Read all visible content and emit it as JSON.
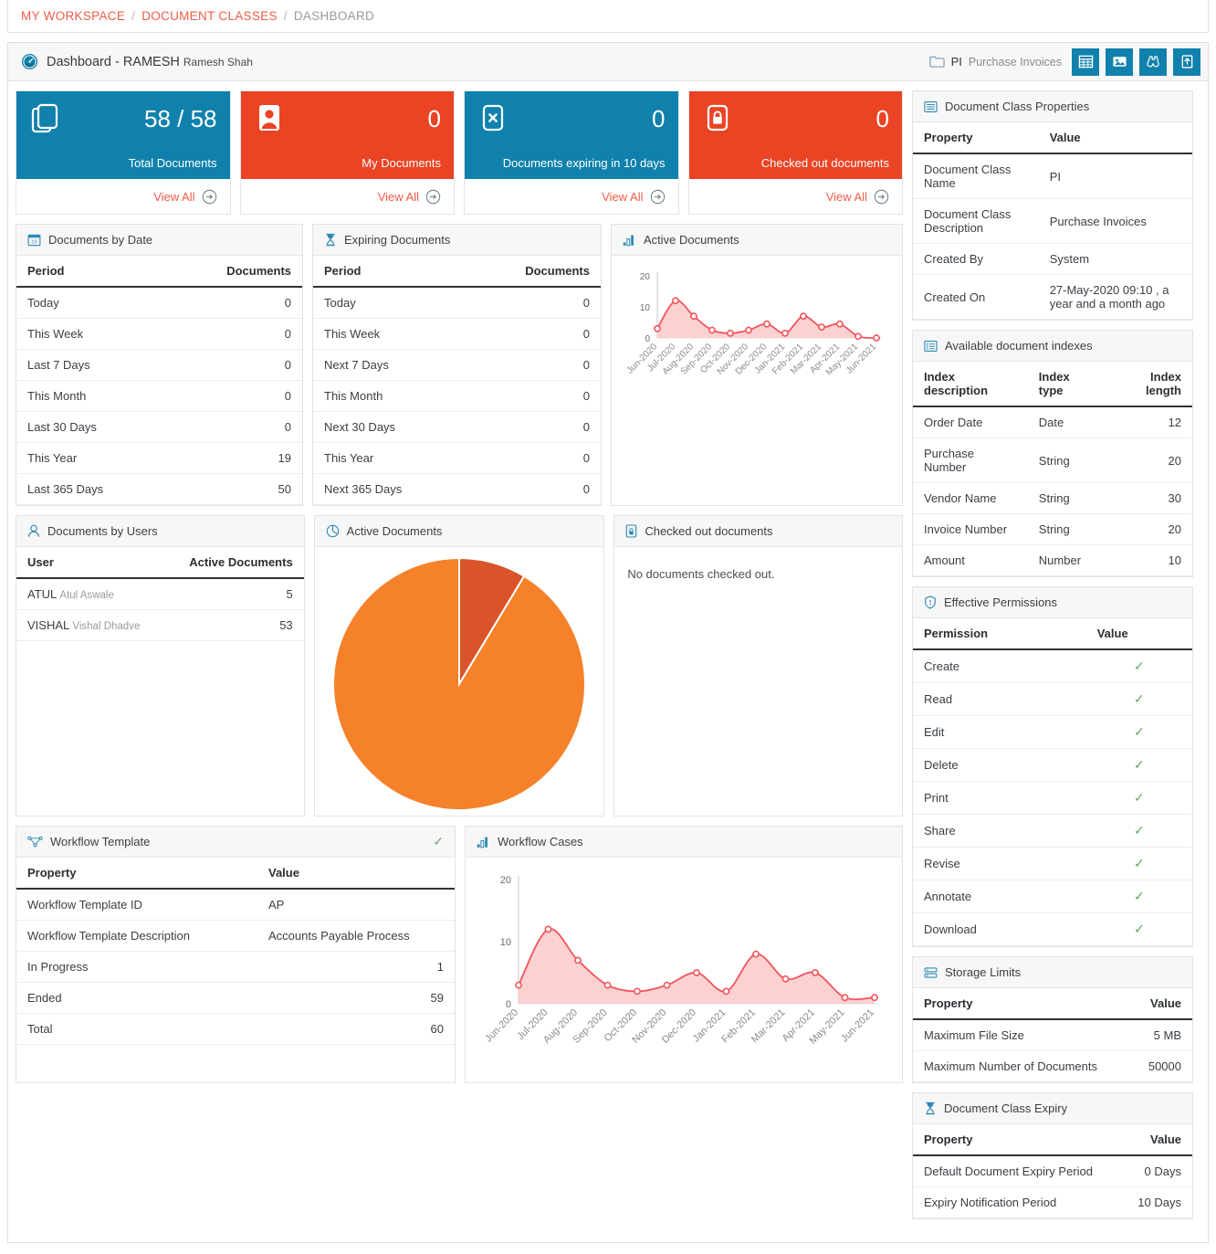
{
  "breadcrumb": {
    "workspace": "MY WORKSPACE",
    "document_classes": "DOCUMENT CLASSES",
    "current": "DASHBOARD",
    "sep": "/"
  },
  "header": {
    "icon": "dashboard-gauge-icon",
    "title_main": "Dashboard - RAMESH ",
    "title_sub": "Ramesh Shah",
    "folder_icon": "folder-icon",
    "folder_code": "PI",
    "folder_desc": "Purchase Invoices",
    "tools": [
      {
        "name": "grid-view-button",
        "icon": "grid-icon"
      },
      {
        "name": "image-view-button",
        "icon": "image-icon"
      },
      {
        "name": "search-button",
        "icon": "binoculars-icon"
      },
      {
        "name": "upload-button",
        "icon": "upload-icon"
      }
    ]
  },
  "kpi_cards": [
    {
      "icon": "documents-stack-icon",
      "value": "58 / 58",
      "label": "Total Documents",
      "color": "blue",
      "view_all": "View All"
    },
    {
      "icon": "user-card-icon",
      "value": "0",
      "label": "My Documents",
      "color": "red",
      "view_all": "View All"
    },
    {
      "icon": "expired-x-icon",
      "value": "0",
      "label": "Documents expiring in 10 days",
      "color": "blue",
      "view_all": "View All"
    },
    {
      "icon": "lock-icon",
      "value": "0",
      "label": "Checked out documents",
      "color": "red",
      "view_all": "View All"
    }
  ],
  "documents_by_date": {
    "icon": "calendar-icon",
    "title": "Documents by Date",
    "columns": [
      "Period",
      "Documents"
    ],
    "rows": [
      [
        "Today",
        "0"
      ],
      [
        "This Week",
        "0"
      ],
      [
        "Last 7 Days",
        "0"
      ],
      [
        "This Month",
        "0"
      ],
      [
        "Last 30 Days",
        "0"
      ],
      [
        "This Year",
        "19"
      ],
      [
        "Last 365 Days",
        "50"
      ]
    ]
  },
  "expiring_documents": {
    "icon": "hourglass-icon",
    "title": "Expiring Documents",
    "columns": [
      "Period",
      "Documents"
    ],
    "rows": [
      [
        "Today",
        "0"
      ],
      [
        "This Week",
        "0"
      ],
      [
        "Next 7 Days",
        "0"
      ],
      [
        "This Month",
        "0"
      ],
      [
        "Next 30 Days",
        "0"
      ],
      [
        "This Year",
        "0"
      ],
      [
        "Next 365 Days",
        "0"
      ]
    ]
  },
  "documents_by_users": {
    "icon": "user-icon",
    "title": "Documents by Users",
    "columns": [
      "User",
      "Active Documents"
    ],
    "rows": [
      {
        "code": "ATUL",
        "name": "Atul Aswale",
        "count": "5"
      },
      {
        "code": "VISHAL",
        "name": "Vishal Dhadve",
        "count": "53"
      }
    ]
  },
  "active_documents_pie": {
    "icon": "pie-chart-icon",
    "title": "Active Documents"
  },
  "checked_out": {
    "icon": "lock-small-icon",
    "title": "Checked out documents",
    "message": "No documents checked out."
  },
  "workflow_template": {
    "icon": "workflow-icon",
    "title": "Workflow Template",
    "status_icon": "check-icon",
    "columns": [
      "Property",
      "Value"
    ],
    "rows": [
      {
        "prop": "Workflow Template ID",
        "value": "AP",
        "align": "left"
      },
      {
        "prop": "Workflow Template Description",
        "value": "Accounts Payable Process",
        "align": "left"
      },
      {
        "prop": "In Progress",
        "value": "1",
        "align": "right"
      },
      {
        "prop": "Ended",
        "value": "59",
        "align": "right"
      },
      {
        "prop": "Total",
        "value": "60",
        "align": "right"
      }
    ]
  },
  "document_class_properties": {
    "icon": "properties-list-icon",
    "title": "Document Class Properties",
    "columns": [
      "Property",
      "Value"
    ],
    "rows": [
      [
        "Document Class Name",
        "PI"
      ],
      [
        "Document Class Description",
        "Purchase Invoices"
      ],
      [
        "Created By",
        "System"
      ],
      [
        "Created On",
        "27-May-2020 09:10 , a year and a month ago"
      ]
    ]
  },
  "available_indexes": {
    "icon": "index-list-icon",
    "title": "Available document indexes",
    "columns": [
      "Index description",
      "Index type",
      "Index length"
    ],
    "rows": [
      [
        "Order Date",
        "Date",
        "12"
      ],
      [
        "Purchase Number",
        "String",
        "20"
      ],
      [
        "Vendor Name",
        "String",
        "30"
      ],
      [
        "Invoice Number",
        "String",
        "20"
      ],
      [
        "Amount",
        "Number",
        "10"
      ]
    ]
  },
  "effective_permissions": {
    "icon": "shield-icon",
    "title": "Effective Permissions",
    "columns": [
      "Permission",
      "Value"
    ],
    "rows": [
      {
        "name": "Create",
        "granted": true
      },
      {
        "name": "Read",
        "granted": true
      },
      {
        "name": "Edit",
        "granted": true
      },
      {
        "name": "Delete",
        "granted": true
      },
      {
        "name": "Print",
        "granted": true
      },
      {
        "name": "Share",
        "granted": true
      },
      {
        "name": "Revise",
        "granted": true
      },
      {
        "name": "Annotate",
        "granted": true
      },
      {
        "name": "Download",
        "granted": true
      }
    ]
  },
  "storage_limits": {
    "icon": "storage-icon",
    "title": "Storage Limits",
    "columns": [
      "Property",
      "Value"
    ],
    "rows": [
      [
        "Maximum File Size",
        "5 MB"
      ],
      [
        "Maximum Number of Documents",
        "50000"
      ]
    ]
  },
  "document_class_expiry": {
    "icon": "hourglass-icon",
    "title": "Document Class Expiry",
    "columns": [
      "Property",
      "Value"
    ],
    "rows": [
      [
        "Default Document Expiry Period",
        "0 Days"
      ],
      [
        "Expiry Notification Period",
        "10 Days"
      ]
    ]
  },
  "colors": {
    "accent_blue": "#1081ac",
    "accent_red": "#ea4425",
    "link_orange": "#ef5b45",
    "chart_line": "#f2545b",
    "chart_fill": "#fbc9c9",
    "pie_light": "#f5822a",
    "pie_dark": "#d9542b",
    "check_green": "#62a86c"
  },
  "chart_data": [
    {
      "id": "active-documents-line",
      "type": "area",
      "title": "Active Documents",
      "xlabel": "",
      "ylabel": "",
      "ylim": [
        0,
        20
      ],
      "yticks": [
        0,
        10,
        20
      ],
      "grid": false,
      "legend": "none",
      "categories": [
        "Jun-2020",
        "Jul-2020",
        "Aug-2020",
        "Sep-2020",
        "Oct-2020",
        "Nov-2020",
        "Dec-2020",
        "Jan-2021",
        "Feb-2021",
        "Mar-2021",
        "Apr-2021",
        "May-2021",
        "Jun-2021"
      ],
      "values": [
        3,
        12,
        7,
        2.5,
        1.5,
        2.5,
        4.5,
        1.5,
        7,
        3.5,
        4.5,
        0.5,
        0
      ],
      "line_color": "#f2545b",
      "fill_color": "#fbc9c9"
    },
    {
      "id": "active-documents-pie",
      "type": "pie",
      "title": "Active Documents",
      "labels": [
        "ATUL Atul Aswale",
        "VISHAL Vishal Dhadve"
      ],
      "values": [
        5,
        53
      ],
      "colors": [
        "#d9542b",
        "#f5822a"
      ],
      "start_angle": 90,
      "legend": "none"
    },
    {
      "id": "workflow-cases-line",
      "type": "area",
      "title": "Workflow Cases",
      "xlabel": "",
      "ylabel": "",
      "ylim": [
        0,
        20
      ],
      "yticks": [
        0,
        10,
        20
      ],
      "grid": false,
      "legend": "none",
      "categories": [
        "Jun-2020",
        "Jul-2020",
        "Aug-2020",
        "Sep-2020",
        "Oct-2020",
        "Nov-2020",
        "Dec-2020",
        "Jan-2021",
        "Feb-2021",
        "Mar-2021",
        "Apr-2021",
        "May-2021",
        "Jun-2021"
      ],
      "values": [
        3,
        12,
        7,
        3,
        2,
        3,
        5,
        2,
        8,
        4,
        5,
        1,
        1
      ],
      "line_color": "#f2545b",
      "fill_color": "#fbc9c9"
    }
  ],
  "workflow_cases_card": {
    "icon": "bar-chart-icon",
    "title": "Workflow Cases"
  },
  "active_documents_card": {
    "icon": "bar-chart-icon",
    "title": "Active Documents"
  }
}
